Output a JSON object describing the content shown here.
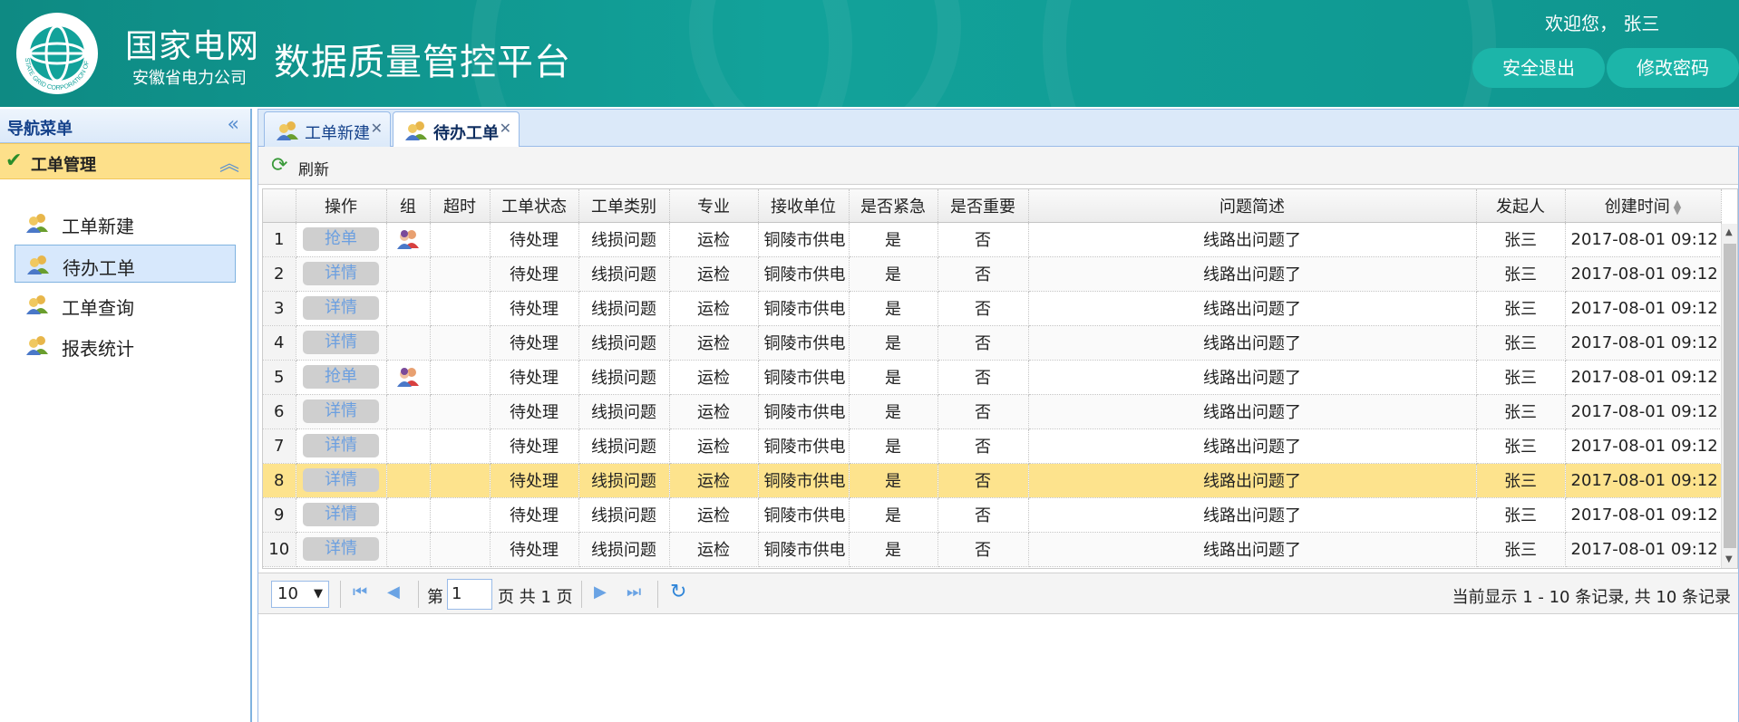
{
  "header": {
    "company": "国家电网",
    "company_sub": "安徽省电力公司",
    "logo_text": "STATE GRID CORPORATION OF CHINA",
    "app_title": "数据质量管控平台",
    "welcome": "欢迎您， 张三",
    "logout_label": "安全退出",
    "change_pwd_label": "修改密码",
    "colors": {
      "header_bg": "#12a29a",
      "button_bg": "#1cb5a9"
    }
  },
  "sidebar": {
    "title": "导航菜单",
    "group_title": "工单管理",
    "items": [
      {
        "label": "工单新建",
        "icon": "users-icon"
      },
      {
        "label": "待办工单",
        "icon": "users-icon",
        "active": true
      },
      {
        "label": "工单查询",
        "icon": "users-icon"
      },
      {
        "label": "报表统计",
        "icon": "users-icon"
      }
    ]
  },
  "tabs": [
    {
      "label": "工单新建",
      "active": false
    },
    {
      "label": "待办工单",
      "active": true
    }
  ],
  "toolbar": {
    "refresh_label": "刷新"
  },
  "grid": {
    "columns": [
      "",
      "操作",
      "组",
      "超时",
      "工单状态",
      "工单类别",
      "专业",
      "接收单位",
      "是否紧急",
      "是否重要",
      "问题简述",
      "发起人",
      "创建时间"
    ],
    "rows": [
      {
        "n": "1",
        "op": "抢单",
        "group": true,
        "status": "待处理",
        "category": "线损问题",
        "major": "运检",
        "unit": "铜陵市供电",
        "urgent": "是",
        "important": "否",
        "desc": "线路出问题了",
        "by": "张三",
        "time": "2017-08-01 09:12"
      },
      {
        "n": "2",
        "op": "详情",
        "group": false,
        "status": "待处理",
        "category": "线损问题",
        "major": "运检",
        "unit": "铜陵市供电",
        "urgent": "是",
        "important": "否",
        "desc": "线路出问题了",
        "by": "张三",
        "time": "2017-08-01 09:12"
      },
      {
        "n": "3",
        "op": "详情",
        "group": false,
        "status": "待处理",
        "category": "线损问题",
        "major": "运检",
        "unit": "铜陵市供电",
        "urgent": "是",
        "important": "否",
        "desc": "线路出问题了",
        "by": "张三",
        "time": "2017-08-01 09:12"
      },
      {
        "n": "4",
        "op": "详情",
        "group": false,
        "status": "待处理",
        "category": "线损问题",
        "major": "运检",
        "unit": "铜陵市供电",
        "urgent": "是",
        "important": "否",
        "desc": "线路出问题了",
        "by": "张三",
        "time": "2017-08-01 09:12"
      },
      {
        "n": "5",
        "op": "抢单",
        "group": true,
        "status": "待处理",
        "category": "线损问题",
        "major": "运检",
        "unit": "铜陵市供电",
        "urgent": "是",
        "important": "否",
        "desc": "线路出问题了",
        "by": "张三",
        "time": "2017-08-01 09:12"
      },
      {
        "n": "6",
        "op": "详情",
        "group": false,
        "status": "待处理",
        "category": "线损问题",
        "major": "运检",
        "unit": "铜陵市供电",
        "urgent": "是",
        "important": "否",
        "desc": "线路出问题了",
        "by": "张三",
        "time": "2017-08-01 09:12"
      },
      {
        "n": "7",
        "op": "详情",
        "group": false,
        "status": "待处理",
        "category": "线损问题",
        "major": "运检",
        "unit": "铜陵市供电",
        "urgent": "是",
        "important": "否",
        "desc": "线路出问题了",
        "by": "张三",
        "time": "2017-08-01 09:12"
      },
      {
        "n": "8",
        "op": "详情",
        "group": false,
        "status": "待处理",
        "category": "线损问题",
        "major": "运检",
        "unit": "铜陵市供电",
        "urgent": "是",
        "important": "否",
        "desc": "线路出问题了",
        "by": "张三",
        "time": "2017-08-01 09:12",
        "selected": true
      },
      {
        "n": "9",
        "op": "详情",
        "group": false,
        "status": "待处理",
        "category": "线损问题",
        "major": "运检",
        "unit": "铜陵市供电",
        "urgent": "是",
        "important": "否",
        "desc": "线路出问题了",
        "by": "张三",
        "time": "2017-08-01 09:12"
      },
      {
        "n": "10",
        "op": "详情",
        "group": false,
        "status": "待处理",
        "category": "线损问题",
        "major": "运检",
        "unit": "铜陵市供电",
        "urgent": "是",
        "important": "否",
        "desc": "线路出问题了",
        "by": "张三",
        "time": "2017-08-01 09:12"
      }
    ],
    "selected_row_color": "#fde38d"
  },
  "pager": {
    "page_size": "10",
    "page_prefix": "第",
    "current_page": "1",
    "page_suffix": "页 共 1 页",
    "info": "当前显示 1 - 10 条记录, 共 10 条记录"
  }
}
